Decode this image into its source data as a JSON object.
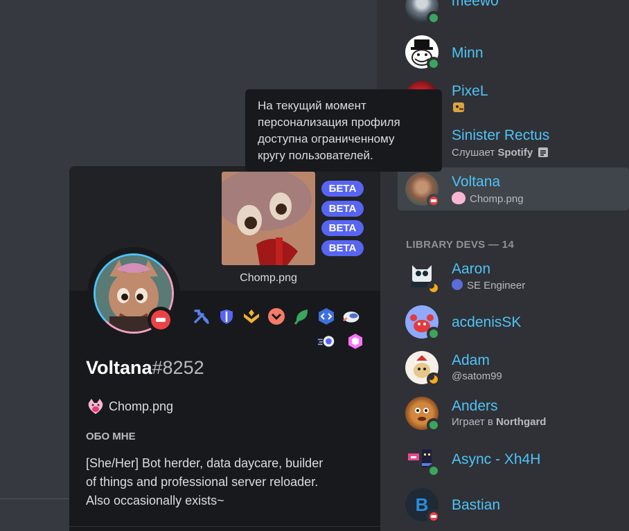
{
  "tooltip": {
    "text_lines": [
      "На текущий момент",
      "персонализация профиля",
      "доступна ограниченному",
      "кругу пользователей."
    ]
  },
  "profile": {
    "banner_caption": "Chomp.png",
    "beta_labels": [
      "БЕТА",
      "BETA",
      "BETA",
      "BETA"
    ],
    "username": "Voltana",
    "discriminator": "#8252",
    "custom_status": "Chomp.png",
    "about_title": "ОБО МНЕ",
    "about_lines": [
      "[She/Her] Bot herder, data daycare, builder",
      "of things and professional server reloader.",
      "Also occasionally exists~"
    ],
    "status": "dnd",
    "badges": [
      "hammer-wrench-icon",
      "shield-icon",
      "hypesquad-balance-icon",
      "chevron-badge-icon",
      "leaf-icon",
      "code-icon",
      "bot-icon",
      "speed-ring-icon",
      "hexagon-icon"
    ]
  },
  "members": {
    "section_header": "LIBRARY DEVS — 14",
    "online_above": [
      {
        "name": "meew0",
        "sub": "",
        "status": "online"
      },
      {
        "name": "Minn",
        "sub": "",
        "status": "online"
      },
      {
        "name": "PixeL",
        "sub": "",
        "status": "dnd"
      },
      {
        "name": "Sinister Rectus",
        "sub_prefix": "Слушает ",
        "sub_bold": "Spotify",
        "status": "online"
      },
      {
        "name": "Voltana",
        "sub": "Chomp.png",
        "status": "dnd"
      }
    ],
    "library_devs": [
      {
        "name": "Aaron",
        "sub": "SE Engineer",
        "status": "idle"
      },
      {
        "name": "acdenisSK",
        "sub": "",
        "status": "online"
      },
      {
        "name": "Adam",
        "sub": "@satom99",
        "status": "idle"
      },
      {
        "name": "Anders",
        "sub_prefix": "Играет в ",
        "sub_bold": "Northgard",
        "status": "online"
      },
      {
        "name": "Async - Xh4H",
        "sub": "",
        "status": "online"
      },
      {
        "name": "Bastian",
        "sub": "",
        "status": "dnd"
      }
    ]
  },
  "colors": {
    "background": "#36393f",
    "sidebar": "#2f3136",
    "popout": "#18191c",
    "name_color": "#4fc3f7",
    "beta_badge": "#5865f2",
    "online": "#3ba55d",
    "dnd": "#ed4245",
    "idle": "#faa81a"
  }
}
